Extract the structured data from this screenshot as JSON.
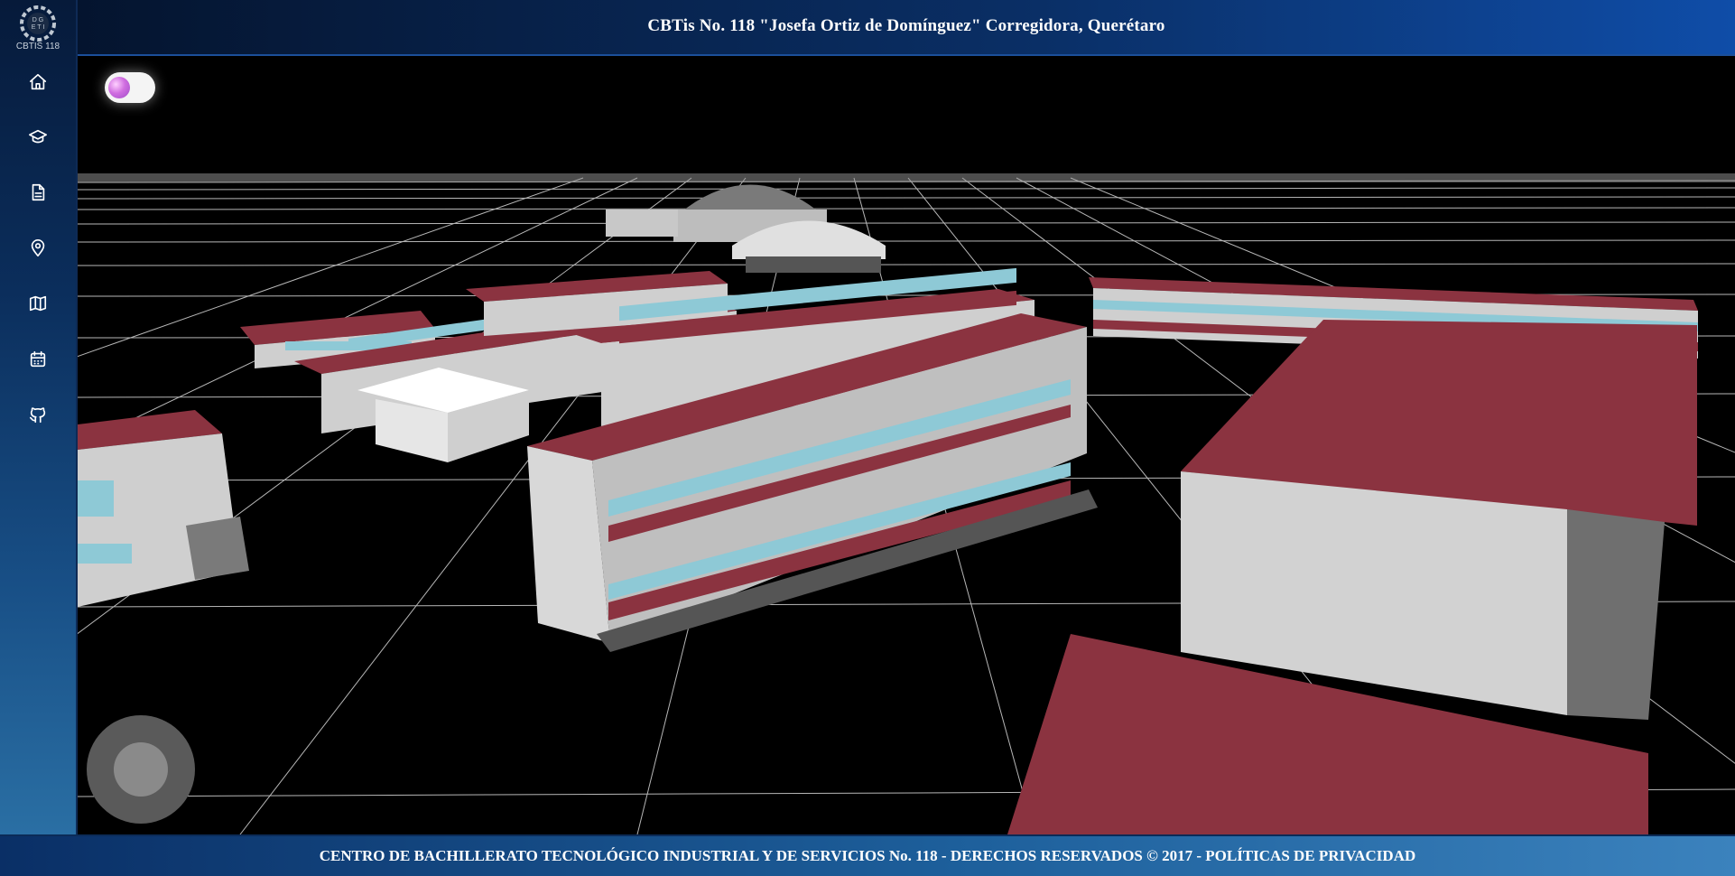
{
  "header": {
    "title": "CBTis No. 118 \"Josefa Ortiz de Domínguez\" Corregidora, Querétaro"
  },
  "logo": {
    "text": "CBTIS 118"
  },
  "sidebar": {
    "items": [
      {
        "icon": "home-icon"
      },
      {
        "icon": "graduation-cap-icon"
      },
      {
        "icon": "document-icon"
      },
      {
        "icon": "location-pin-icon"
      },
      {
        "icon": "map-icon"
      },
      {
        "icon": "calendar-icon"
      },
      {
        "icon": "github-icon"
      }
    ]
  },
  "scene": {
    "theme_toggle": {
      "icon": "theme-toggle"
    },
    "joystick": {
      "icon": "joystick"
    }
  },
  "footer": {
    "text": "CENTRO DE BACHILLERATO TECNOLÓGICO INDUSTRIAL Y DE SERVICIOS No. 118 - DERECHOS RESERVADOS © 2017 - POLÍTICAS DE PRIVACIDAD"
  },
  "colors": {
    "roof": "#8b3340",
    "wall": "#cfcfcf",
    "grid": "#d8d8d8",
    "background": "#000000",
    "header_dark": "#04122a",
    "header_light": "#0f4da8"
  }
}
